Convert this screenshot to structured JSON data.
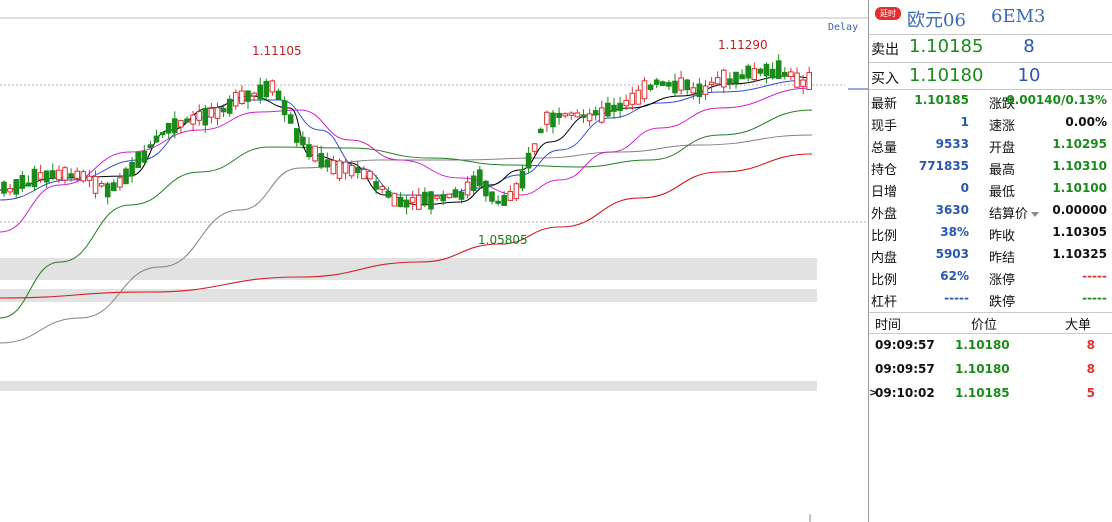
{
  "chart": {
    "delay_label": "Delay",
    "high_label_1": "1.11105",
    "high_label_2": "1.11290",
    "low_label": "1.05805",
    "colors": {
      "up": "#e03030",
      "down": "#1a8a1a",
      "ma5": "#000000",
      "ma10": "#3050d0",
      "ma20": "#d020d0",
      "ma60": "#208020",
      "ma120": "#808080",
      "ma250": "#d02020"
    }
  },
  "header": {
    "badge": "延时",
    "name": "欧元06",
    "code": "6EM3"
  },
  "quotes": {
    "sell": {
      "label": "卖出",
      "price": "1.10185",
      "volume": "8"
    },
    "buy": {
      "label": "买入",
      "price": "1.10180",
      "volume": "10"
    }
  },
  "stats": {
    "left": [
      {
        "label": "最新",
        "value": "1.10185",
        "color": "green"
      },
      {
        "label": "现手",
        "value": "1",
        "color": "blue"
      },
      {
        "label": "总量",
        "value": "9533",
        "color": "blue"
      },
      {
        "label": "持仓",
        "value": "771835",
        "color": "blue"
      },
      {
        "label": "日增",
        "value": "0",
        "color": "blue"
      },
      {
        "label": "外盘",
        "value": "3630",
        "color": "blue"
      },
      {
        "label": "比例",
        "value": "38%",
        "color": "blue"
      },
      {
        "label": "内盘",
        "value": "5903",
        "color": "blue"
      },
      {
        "label": "比例",
        "value": "62%",
        "color": "blue"
      },
      {
        "label": "杠杆",
        "value": "-----",
        "color": "blue"
      }
    ],
    "right": [
      {
        "label": "涨跌",
        "value": "-0.00140/0.13%",
        "color": "green"
      },
      {
        "label": "速涨",
        "value": "0.00%",
        "color": "black"
      },
      {
        "label": "开盘",
        "value": "1.10295",
        "color": "green"
      },
      {
        "label": "最高",
        "value": "1.10310",
        "color": "green"
      },
      {
        "label": "最低",
        "value": "1.10100",
        "color": "green"
      },
      {
        "label": "结算价",
        "value": "0.00000",
        "color": "black"
      },
      {
        "label": "昨收",
        "value": "1.10305",
        "color": "black"
      },
      {
        "label": "昨结",
        "value": "1.10325",
        "color": "black"
      },
      {
        "label": "涨停",
        "value": "-----",
        "color": "red"
      },
      {
        "label": "跌停",
        "value": "-----",
        "color": "green"
      }
    ]
  },
  "ticks": {
    "headers": {
      "time": "时间",
      "price": "价位",
      "size": "大单"
    },
    "rows": [
      {
        "time": "09:09:57",
        "price": "1.10180",
        "size": "8"
      },
      {
        "time": "09:09:57",
        "price": "1.10180",
        "size": "8"
      },
      {
        "time": "09:10:02",
        "price": "1.10185",
        "size": "5"
      }
    ]
  }
}
